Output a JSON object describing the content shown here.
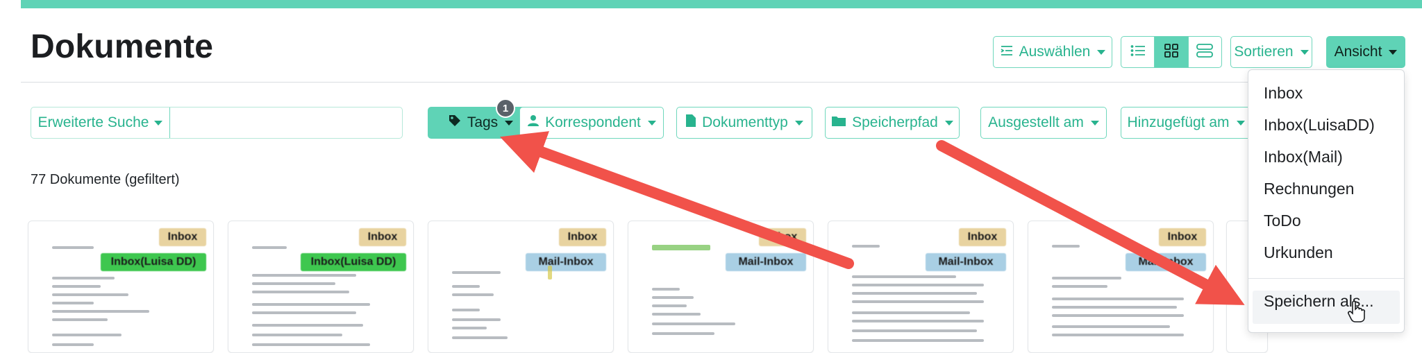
{
  "page": {
    "title": "Dokumente"
  },
  "toolbar": {
    "select_label": "Auswählen",
    "sort_label": "Sortieren",
    "view_label": "Ansicht",
    "view_modes": [
      "list-icon",
      "grid-icon",
      "large-cards-icon"
    ],
    "active_view_mode": "grid-icon"
  },
  "filters": {
    "advanced_search_label": "Erweiterte Suche",
    "search_value": "",
    "tags_label": "Tags",
    "tags_badge": "1",
    "correspondent_label": "Korrespondent",
    "doctype_label": "Dokumenttyp",
    "storagepath_label": "Speicherpfad",
    "issued_label": "Ausgestellt am",
    "added_label": "Hinzugefügt am"
  },
  "results": {
    "count_text": "77 Dokumente (gefiltert)"
  },
  "cards": [
    {
      "tags": [
        {
          "label": "Inbox",
          "color": "#e8d3a0"
        },
        {
          "label": "Inbox(Luisa DD)",
          "color": "#3ec74f"
        }
      ]
    },
    {
      "tags": [
        {
          "label": "Inbox",
          "color": "#e8d3a0"
        },
        {
          "label": "Inbox(Luisa DD)",
          "color": "#3ec74f"
        }
      ]
    },
    {
      "tags": [
        {
          "label": "Inbox",
          "color": "#e8d3a0"
        },
        {
          "label": "Mail-Inbox",
          "color": "#a9cfe4"
        }
      ]
    },
    {
      "tags": [
        {
          "label": "Inbox",
          "color": "#e8d3a0"
        },
        {
          "label": "Mail-Inbox",
          "color": "#a9cfe4"
        }
      ]
    },
    {
      "tags": [
        {
          "label": "Inbox",
          "color": "#e8d3a0"
        },
        {
          "label": "Mail-Inbox",
          "color": "#a9cfe4"
        }
      ]
    },
    {
      "tags": [
        {
          "label": "Inbox",
          "color": "#e8d3a0"
        },
        {
          "label": "Mail-Inbox",
          "color": "#a9cfe4"
        }
      ]
    }
  ],
  "view_menu": {
    "items": [
      "Inbox",
      "Inbox(LuisaDD)",
      "Inbox(Mail)",
      "Rechnungen",
      "ToDo",
      "Urkunden"
    ],
    "save_as": "Speichern als..."
  },
  "colors": {
    "accent": "#5fd3b6",
    "accent_text": "#28b38e",
    "arrow": "#f1524a"
  }
}
